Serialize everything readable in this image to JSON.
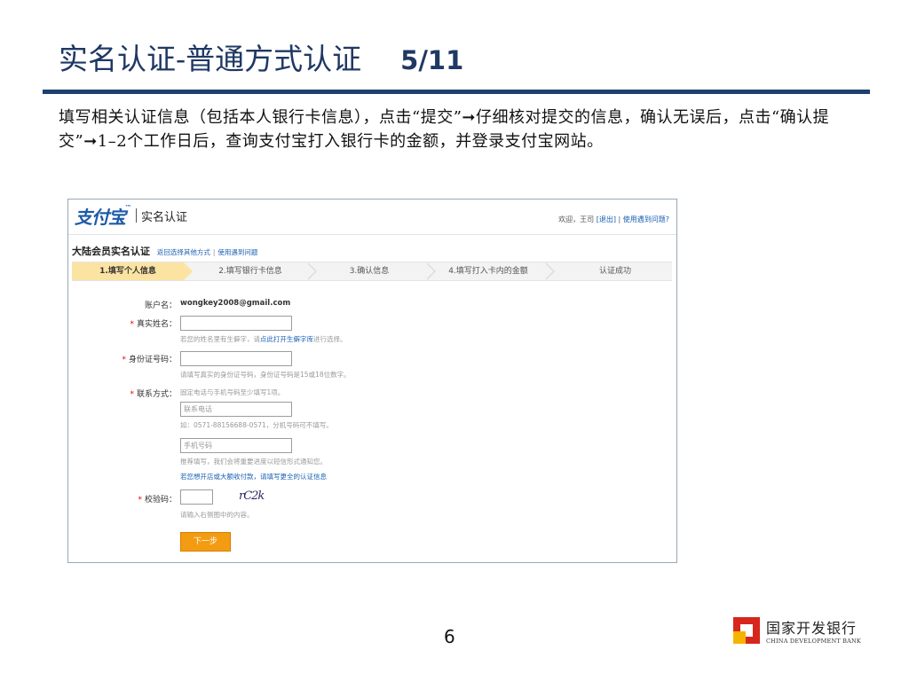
{
  "slide": {
    "title": "实名认证-普通方式认证",
    "page_fraction": "5/11",
    "description": "填写相关认证信息（包括本人银行卡信息），点击“提交”➞仔细核对提交的信息，确认无误后，点击“确认提交”➞1–2个工作日后，查询支付宝打入银行卡的金额，并登录支付宝网站。",
    "page_number": "6"
  },
  "bank": {
    "name_cn": "国家开发银行",
    "name_en": "CHINA DEVELOPMENT BANK"
  },
  "screenshot": {
    "logo": "支付宝",
    "logo_tm": "™",
    "header_title": "实名认证",
    "header_links": {
      "welcome": "欢迎，王司",
      "logout": "[退出]",
      "divider": "|",
      "help": "使用遇到问题?"
    },
    "section": {
      "title": "大陆会员实名认证",
      "link_back": "返回选择其他方式",
      "link_divider": "|",
      "link_help": "使用遇到问题"
    },
    "steps": [
      {
        "label": "1.填写个人信息",
        "active": true
      },
      {
        "label": "2.填写银行卡信息",
        "active": false
      },
      {
        "label": "3.确认信息",
        "active": false
      },
      {
        "label": "4.填写打入卡内的金额",
        "active": false
      },
      {
        "label": "认证成功",
        "active": false
      }
    ],
    "form": {
      "account_label": "账户名：",
      "account_value": "wongkey2008@gmail.com",
      "required_mark": "*",
      "realname_label": "真实姓名：",
      "realname_hint_pre": "若您的姓名里有生僻字，请",
      "realname_hint_link": "点此打开生僻字库",
      "realname_hint_post": "进行选择。",
      "idcard_label": "身份证号码：",
      "idcard_hint": "请填写真实的身份证号码，身份证号码是15或18位数字。",
      "contact_label": "联系方式：",
      "contact_hint": "固定电话与手机号码至少填写1项。",
      "phone_placeholder": "联系电话",
      "phone_hint": "如：0571-88156688-0571，分机号码可不填写。",
      "mobile_placeholder": "手机号码",
      "mobile_hint": "推荐填写，我们会将重要进度以短信形式通知您。",
      "merchant_link": "若您想开店或大额收付款，请填写更全的认证信息",
      "captcha_label": "校验码：",
      "captcha_text": "rC2k",
      "captcha_hint": "请输入右侧图中的内容。",
      "next_button": "下一步"
    }
  }
}
